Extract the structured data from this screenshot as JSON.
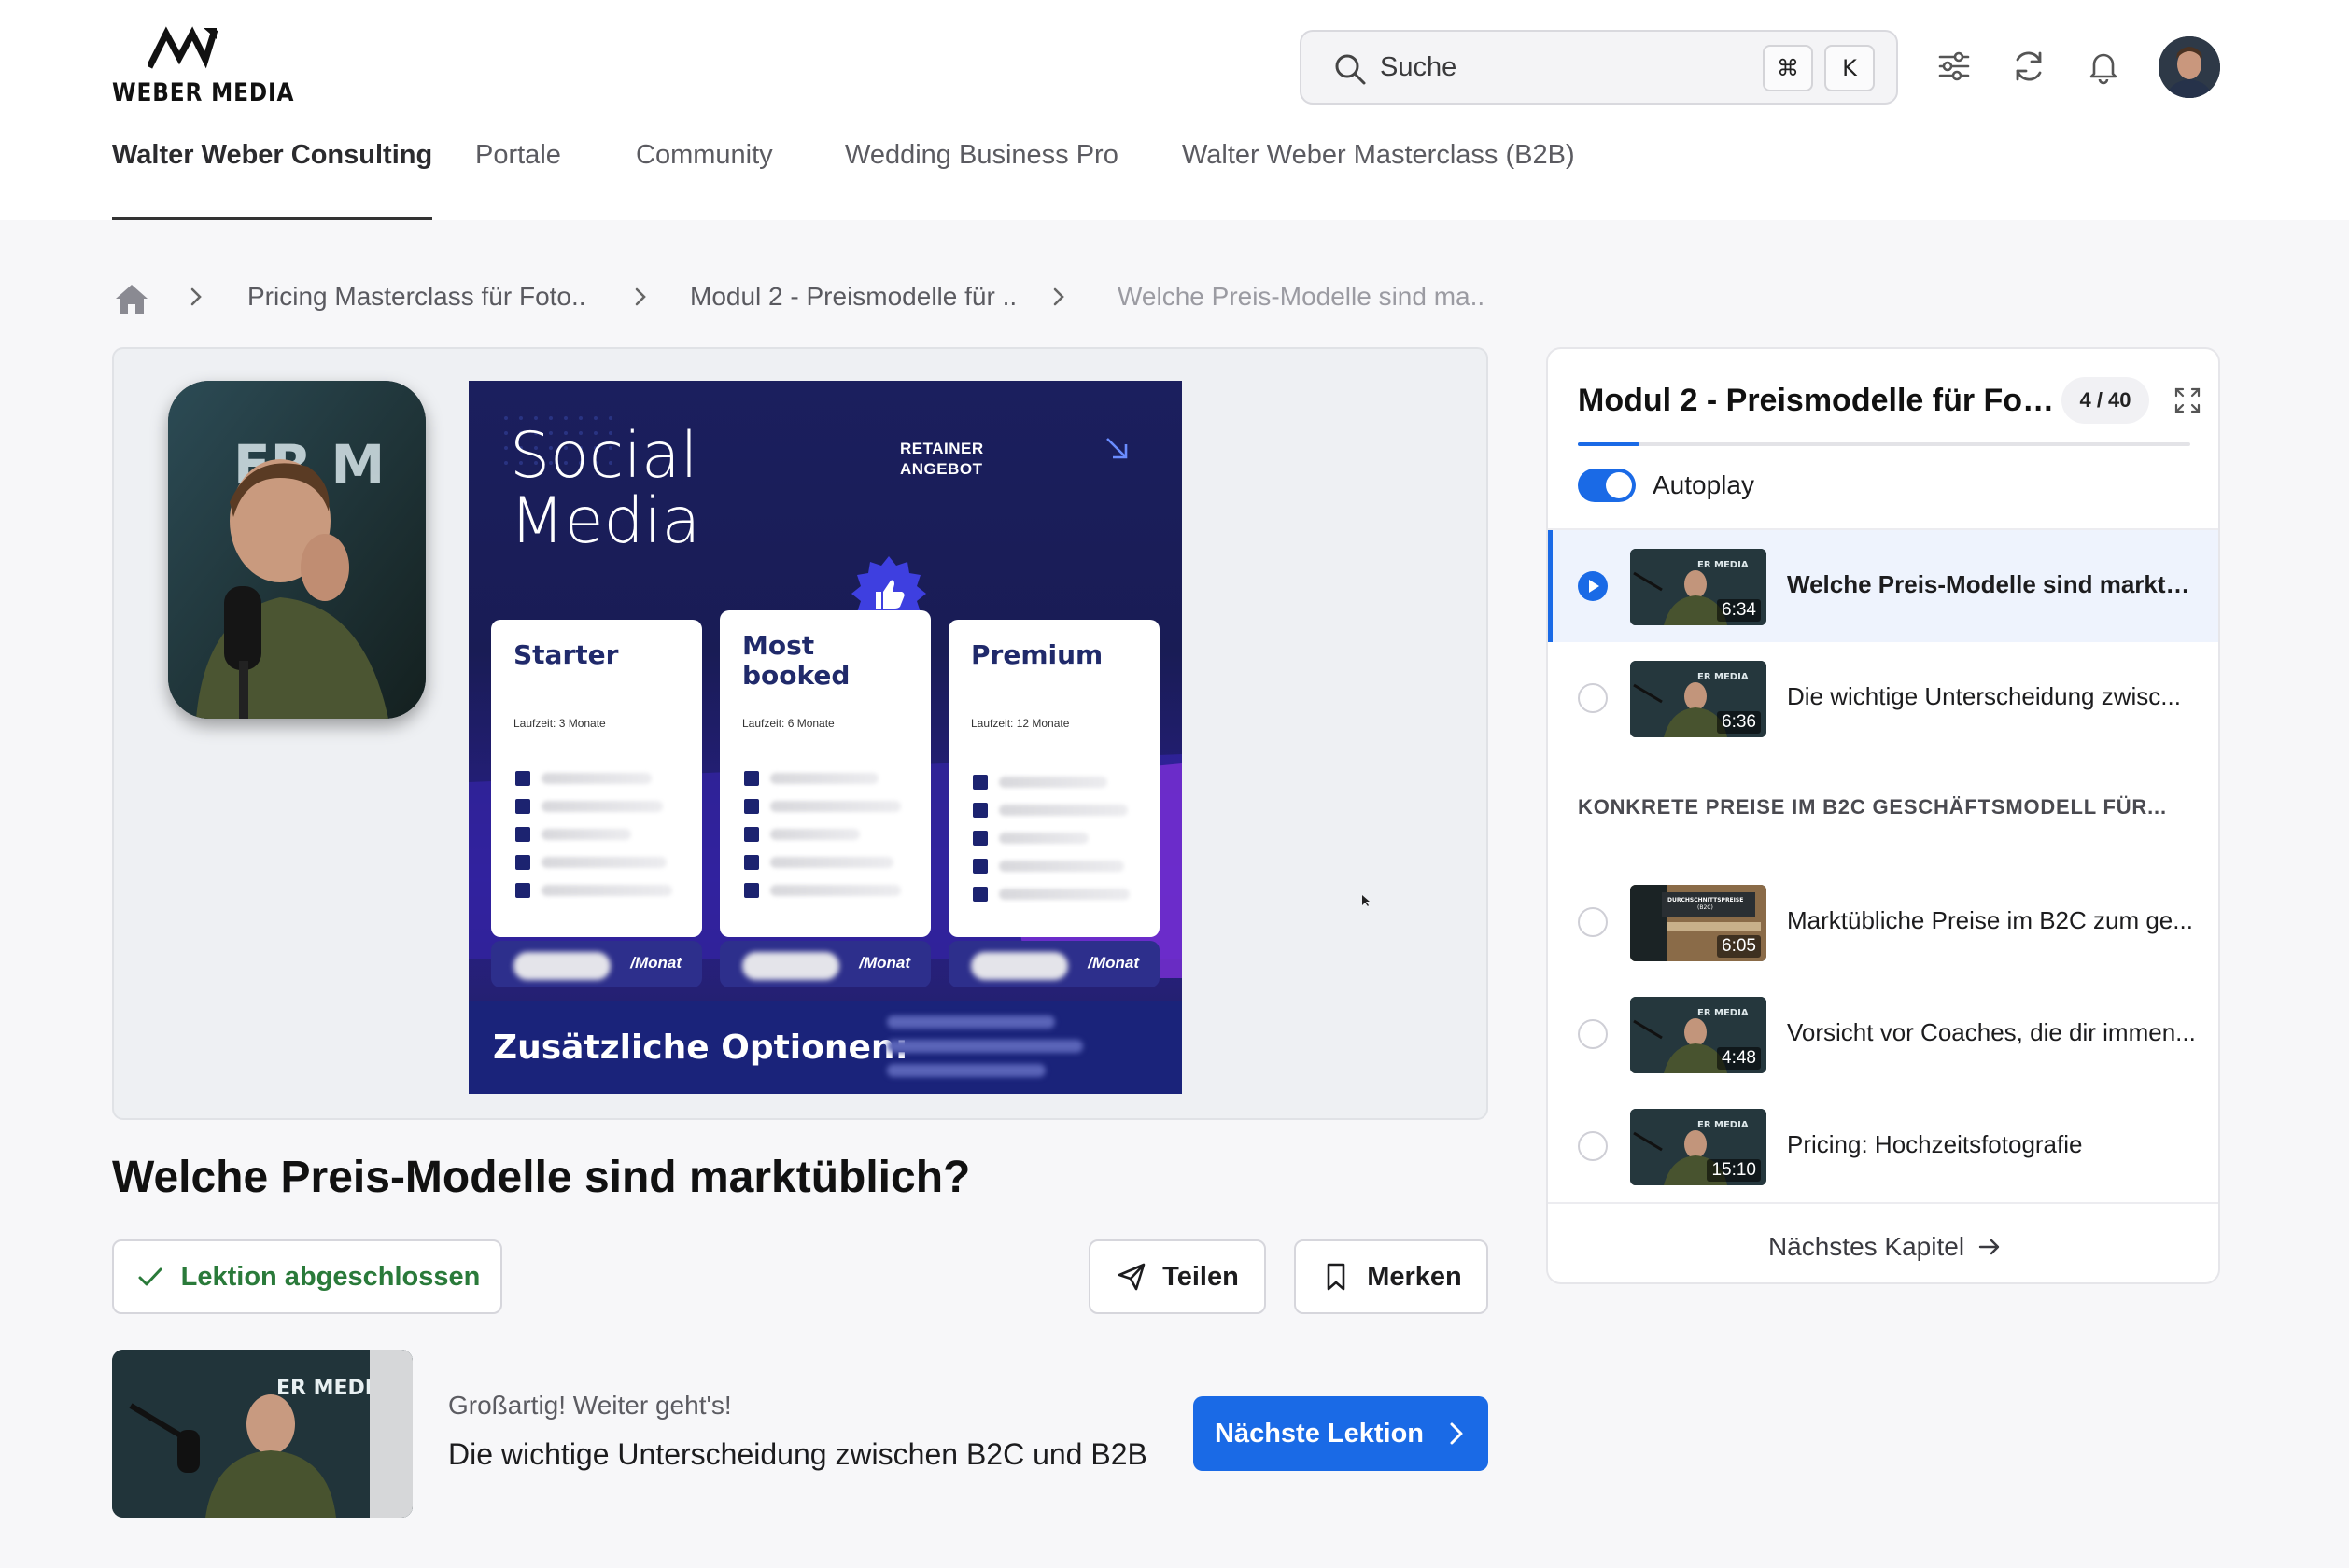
{
  "brand": {
    "name": "WEBER MEDIA"
  },
  "search": {
    "placeholder": "Suche",
    "shortcut_mod": "⌘",
    "shortcut_key": "K"
  },
  "nav": {
    "tabs": [
      {
        "label": "Walter Weber Consulting",
        "active": true
      },
      {
        "label": "Portale"
      },
      {
        "label": "Community"
      },
      {
        "label": "Wedding Business Pro"
      },
      {
        "label": "Walter Weber Masterclass (B2B)"
      }
    ]
  },
  "breadcrumb": {
    "items": [
      "Pricing Masterclass für Foto..",
      "Modul 2 - Preismodelle für ..",
      "Welche Preis-Modelle sind ma.."
    ]
  },
  "video": {
    "slide": {
      "title_line1": "Social",
      "title_line2": "Media",
      "kicker_line1": "RETAINER",
      "kicker_line2": "ANGEBOT",
      "cards": [
        {
          "name_line1": "Starter",
          "name_line2": "",
          "term": "Laufzeit: 3 Monate",
          "unit": "/Monat"
        },
        {
          "name_line1": "Most",
          "name_line2": "booked",
          "term": "Laufzeit: 6 Monate",
          "unit": "/Monat"
        },
        {
          "name_line1": "Premium",
          "name_line2": "",
          "term": "Laufzeit: 12 Monate",
          "unit": "/Monat"
        }
      ],
      "options_label": "Zusätzliche Optionen:"
    }
  },
  "lesson": {
    "title": "Welche Preis-Modelle sind marktüblich?",
    "done_label": "Lektion abgeschlossen",
    "share_label": "Teilen",
    "save_label": "Merken"
  },
  "next": {
    "kicker": "Großartig! Weiter geht's!",
    "title": "Die wichtige Unterscheidung zwischen B2C und B2B",
    "button_label": "Nächste Lektion"
  },
  "sidebar": {
    "title": "Modul 2 - Preismodelle für Foto- ...",
    "count": "4 / 40",
    "progress": 0.1,
    "autoplay_label": "Autoplay",
    "autoplay_on": true,
    "lessons": [
      {
        "label": "Welche Preis-Modelle sind marktüb...",
        "duration": "6:34",
        "active": true
      },
      {
        "label": "Die wichtige Unterscheidung zwisc...",
        "duration": "6:36"
      }
    ],
    "section_label": "KONKRETE PREISE IM B2C GESCHÄFTSMODELL FÜR...",
    "section_lessons": [
      {
        "label": "Marktübliche Preise im B2C zum ge...",
        "duration": "6:05"
      },
      {
        "label": "Vorsicht vor Coaches, die dir immen...",
        "duration": "4:48"
      },
      {
        "label": "Pricing: Hochzeitsfotografie",
        "duration": "15:10"
      }
    ],
    "next_chapter_label": "Nächstes Kapitel"
  },
  "colors": {
    "accent": "#1a6ae6",
    "success": "#2a7a3a",
    "slide_bg": "#1b1f5e"
  }
}
